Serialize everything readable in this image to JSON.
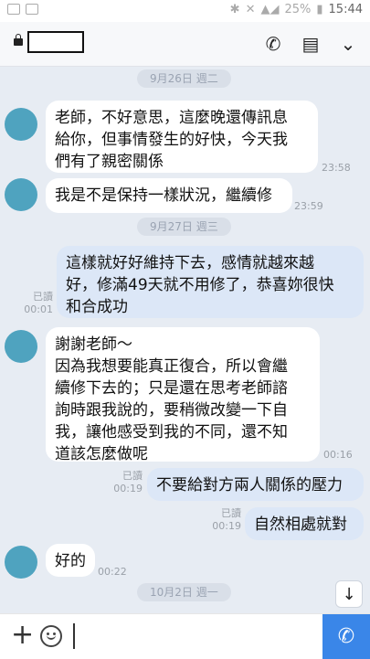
{
  "status_bar": {
    "battery": "25%",
    "time": "15:44",
    "signal": "▲◢"
  },
  "header": {
    "contact_name": "",
    "call_icon": "phone-icon",
    "notes_icon": "notes-icon",
    "menu_icon": "chevron-down-icon"
  },
  "dates": [
    "9月26日 週二",
    "9月27日 週三",
    "10月2日 週一"
  ],
  "messages": [
    {
      "side": "in",
      "text": "老師，不好意思，這麼晚還傳訊息\n給你，但事情發生的好快，今天我\n們有了親密關係",
      "time": "23:58"
    },
    {
      "side": "in",
      "text": "我是不是保持一樣狀況，繼續修",
      "time": "23:59"
    },
    {
      "side": "out",
      "text": "這樣就好好維持下去，感情就越來越\n好，修滿49天就不用修了，恭喜妳很快\n和合成功",
      "read": "已讀",
      "time": "00:01"
    },
    {
      "side": "in",
      "text": "謝謝老師～\n因為我想要能真正復合，所以會繼\n續修下去的；只是還在思考老師諮\n詢時跟我說的，要稍微改變一下自\n我，讓他感受到我的不同，還不知\n道該怎麼做呢",
      "time": "00:16"
    },
    {
      "side": "out",
      "text": "不要給對方兩人關係的壓力",
      "read": "已讀",
      "time": "00:19"
    },
    {
      "side": "out",
      "text": "自然相處就對",
      "read": "已讀",
      "time": "00:19"
    },
    {
      "side": "in",
      "text": "好的",
      "time": "00:22"
    }
  ],
  "input": {
    "placeholder": ""
  }
}
